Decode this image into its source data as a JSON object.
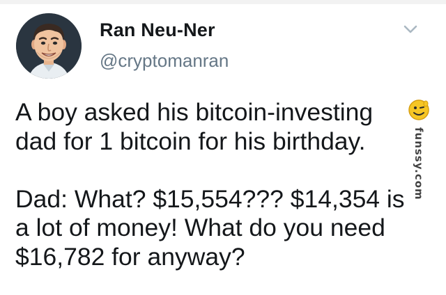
{
  "author": {
    "display_name": "Ran Neu-Ner",
    "handle": "@cryptomanran",
    "avatar": "avatar-photo"
  },
  "menu": {
    "icon": "chevron-down-icon"
  },
  "tweet": {
    "paragraphs": [
      {
        "lines": [
          "A boy asked his bitcoin-investing",
          "dad for 1 bitcoin for his birthday."
        ]
      },
      {
        "lines": [
          "Dad: What? $15,554??? $14,354 is",
          "a lot of money! What do you need",
          "$16,782 for anyway?"
        ]
      }
    ]
  },
  "watermark": {
    "text": "funssy.com",
    "icon": "smiley-face-icon"
  },
  "colors": {
    "text": "#14171a",
    "handle": "#657786",
    "chevron": "#aab8c2",
    "avatar_bg": "#2a3540"
  }
}
